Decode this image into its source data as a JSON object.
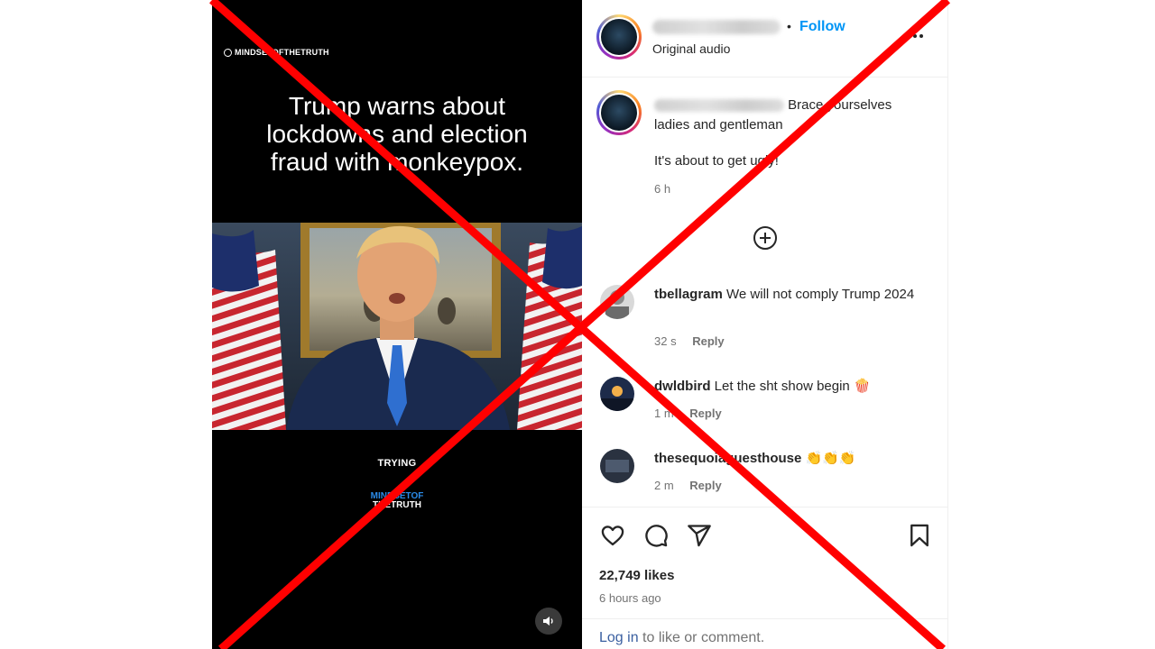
{
  "video": {
    "watermark": "MINDSETOFTHETRUTH",
    "headline": "Trump warns about\nlockdowns and election\nfraud with monkeypox.",
    "brand_top": "TRYING",
    "brand_logo_line1": "MINDSETOF",
    "brand_logo_line2": "THETRUTH"
  },
  "header": {
    "username": "mindsetofthetruth",
    "separator": "•",
    "follow_label": "Follow",
    "audio_label": "Original audio"
  },
  "caption": {
    "username": "mindsetofthetruth",
    "text_line1": "Brace yourselves ladies and gentleman",
    "text_line2": "It's about to get ugly!",
    "time": "6 h"
  },
  "comments": [
    {
      "username": "tbellagram",
      "text": "We will not comply Trump 2024",
      "time": "32 s",
      "reply": "Reply"
    },
    {
      "username": "dwldbird",
      "text": "Let the sht show begin 🍿",
      "time": "1 m",
      "reply": "Reply"
    },
    {
      "username": "thesequoiaguesthouse",
      "text": "👏👏👏",
      "time": "2 m",
      "reply": "Reply"
    }
  ],
  "footer": {
    "likes": "22,749 likes",
    "posted": "6 hours ago",
    "login_link": "Log in",
    "login_rest": " to like or comment."
  },
  "colors": {
    "follow_blue": "#0095f6",
    "overlay_red": "#ff0000",
    "video_bg": "#000000"
  },
  "icons": [
    "more-options-icon",
    "add-comment-icon",
    "heart-icon",
    "comment-icon",
    "share-icon",
    "bookmark-icon",
    "speaker-icon"
  ]
}
